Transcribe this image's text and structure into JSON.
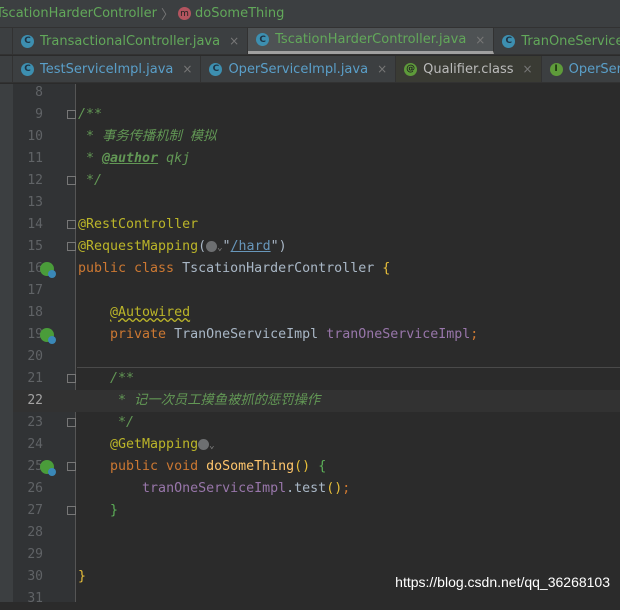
{
  "breadcrumb": {
    "class": "TscationHarderController",
    "method_icon": "m",
    "method": "doSomeThing"
  },
  "tabs_row1": [
    {
      "label": "TransactionalController.java",
      "icon": "C",
      "color": "green"
    },
    {
      "label": "TscationHarderController.java",
      "icon": "C",
      "color": "green",
      "active": true
    },
    {
      "label": "TranOneServiceImpl.java",
      "icon": "C",
      "color": "green"
    }
  ],
  "tabs_row2": [
    {
      "label": "TestServiceImpl.java",
      "icon": "C",
      "color": "blue"
    },
    {
      "label": "OperServiceImpl.java",
      "icon": "C",
      "color": "blue"
    },
    {
      "label": "Qualifier.class",
      "icon": "@",
      "color": "white",
      "selected": true
    },
    {
      "label": "OperService.java",
      "icon": "I",
      "color": "blue"
    }
  ],
  "close_glyph": "×",
  "current_line": 22,
  "code": [
    {
      "n": 8,
      "tokens": []
    },
    {
      "n": 9,
      "fold": true,
      "tokens": [
        {
          "t": "/**",
          "c": "doc"
        }
      ]
    },
    {
      "n": 10,
      "tokens": [
        {
          "t": " * 事务传播机制 模拟",
          "c": "doc"
        }
      ]
    },
    {
      "n": 11,
      "tokens": [
        {
          "t": " * ",
          "c": "doc"
        },
        {
          "t": "@author",
          "c": "doctag"
        },
        {
          "t": " qkj",
          "c": "doc"
        }
      ]
    },
    {
      "n": 12,
      "fold": true,
      "tokens": [
        {
          "t": " */",
          "c": "doc"
        }
      ]
    },
    {
      "n": 13,
      "tokens": []
    },
    {
      "n": 14,
      "fold": true,
      "tokens": [
        {
          "t": "@RestController",
          "c": "ann"
        }
      ]
    },
    {
      "n": 15,
      "fold": true,
      "tokens": [
        {
          "t": "@RequestMapping",
          "c": "ann"
        },
        {
          "t": "(",
          "c": "pl"
        },
        {
          "t": "",
          "c": "globe"
        },
        {
          "t": "⌄",
          "c": "chev"
        },
        {
          "t": "\"",
          "c": "pl"
        },
        {
          "t": "/hard",
          "c": "url"
        },
        {
          "t": "\")",
          "c": "pl"
        }
      ]
    },
    {
      "n": 16,
      "gicon": "bean-class-icon",
      "tokens": [
        {
          "t": "public class ",
          "c": "kw"
        },
        {
          "t": "TscationHarderController ",
          "c": "cls"
        },
        {
          "t": "{",
          "c": "by"
        }
      ]
    },
    {
      "n": 17,
      "tokens": []
    },
    {
      "n": 18,
      "tokens": [
        {
          "t": "    ",
          "c": "pl"
        },
        {
          "t": "@Autowired",
          "c": "ann squig"
        }
      ]
    },
    {
      "n": 19,
      "gicon": "bean-inject-icon",
      "tokens": [
        {
          "t": "    private ",
          "c": "kw"
        },
        {
          "t": "TranOneServiceImpl ",
          "c": "cls"
        },
        {
          "t": "tranOneServiceImpl",
          "c": "fld"
        },
        {
          "t": ";",
          "c": "kw"
        }
      ]
    },
    {
      "n": 20,
      "tokens": []
    },
    {
      "n": 21,
      "fold": true,
      "tokens": [
        {
          "t": "    /**",
          "c": "doc"
        }
      ]
    },
    {
      "n": 22,
      "tokens": [
        {
          "t": "     * 记一次员工摸鱼被抓的惩罚操作",
          "c": "doc"
        }
      ]
    },
    {
      "n": 23,
      "fold": true,
      "tokens": [
        {
          "t": "     */",
          "c": "doc"
        }
      ]
    },
    {
      "n": 24,
      "tokens": [
        {
          "t": "    @GetMapping",
          "c": "ann"
        },
        {
          "t": "",
          "c": "globe"
        },
        {
          "t": "⌄",
          "c": "chev"
        }
      ]
    },
    {
      "n": 25,
      "fold": true,
      "gicon": "web-endpoint-icon",
      "tokens": [
        {
          "t": "    public void ",
          "c": "kw"
        },
        {
          "t": "doSomeThing",
          "c": "mth"
        },
        {
          "t": "() ",
          "c": "by"
        },
        {
          "t": "{",
          "c": "bg"
        }
      ]
    },
    {
      "n": 26,
      "tokens": [
        {
          "t": "        ",
          "c": "pl"
        },
        {
          "t": "tranOneServiceImpl",
          "c": "fld"
        },
        {
          "t": ".test",
          "c": "pl"
        },
        {
          "t": "()",
          "c": "by"
        },
        {
          "t": ";",
          "c": "kw"
        }
      ]
    },
    {
      "n": 27,
      "fold": true,
      "tokens": [
        {
          "t": "    }",
          "c": "bg"
        }
      ]
    },
    {
      "n": 28,
      "tokens": []
    },
    {
      "n": 29,
      "tokens": []
    },
    {
      "n": 30,
      "tokens": [
        {
          "t": "}",
          "c": "by"
        }
      ]
    },
    {
      "n": 31,
      "tokens": []
    }
  ],
  "watermark": "https://blog.csdn.net/qq_36268103"
}
